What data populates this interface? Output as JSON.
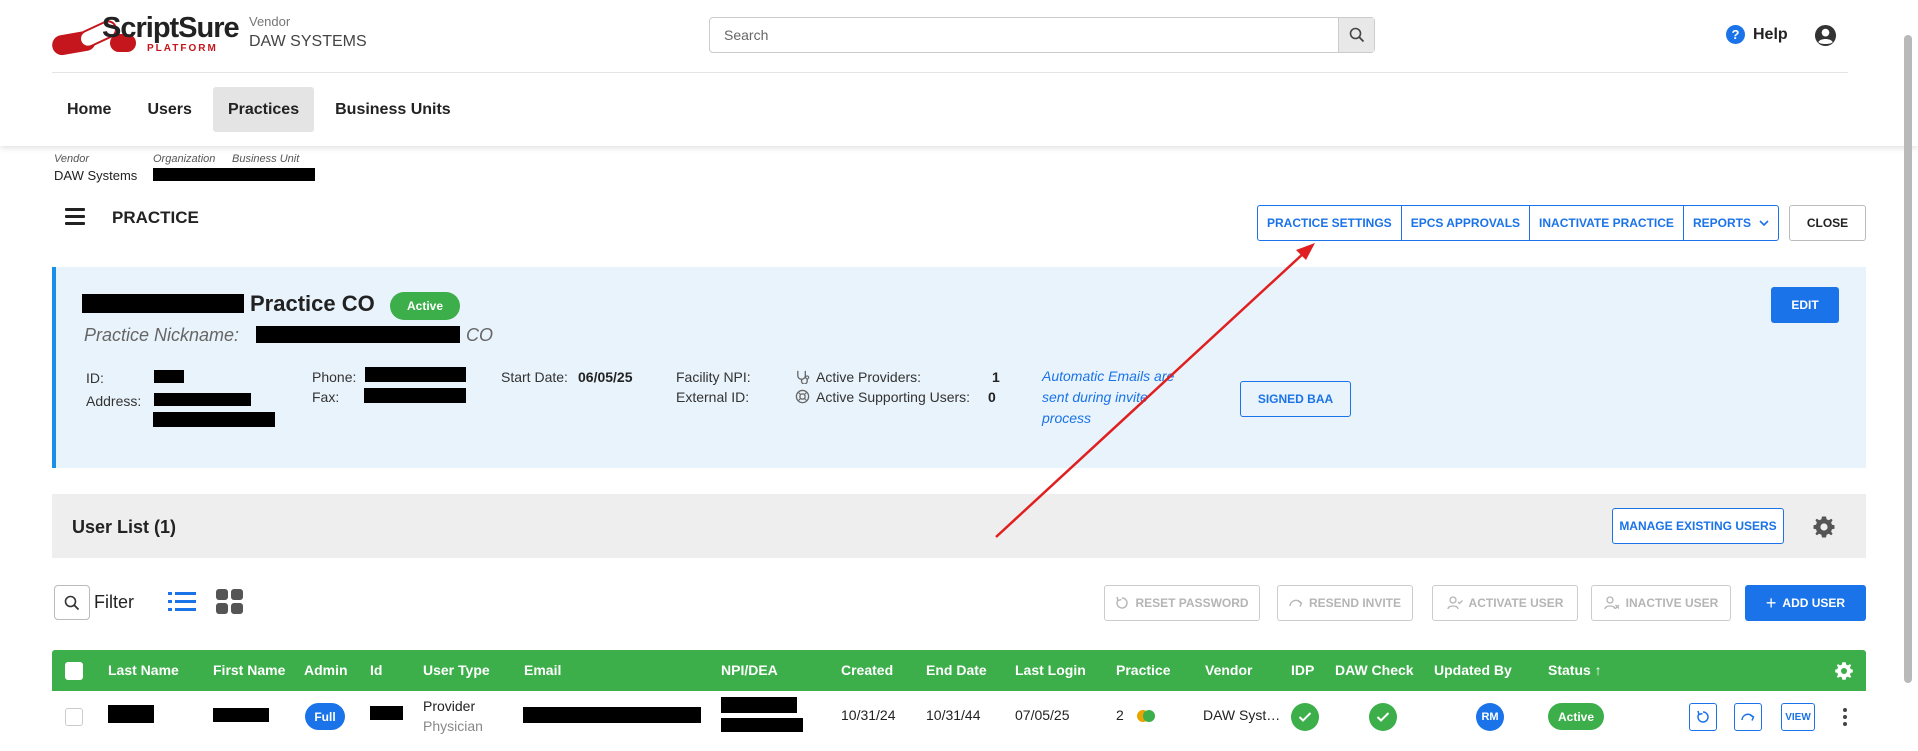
{
  "app": {
    "logo_text": "ScriptSure",
    "logo_sub": "PLATFORM",
    "vendor_label": "Vendor",
    "vendor_name": "DAW SYSTEMS"
  },
  "search": {
    "placeholder": "Search",
    "icon": "search-icon"
  },
  "header": {
    "help_label": "Help",
    "help_icon": "question-circle-icon",
    "account_icon": "user-circle-icon"
  },
  "nav": {
    "tabs": [
      {
        "label": "Home",
        "active": false
      },
      {
        "label": "Users",
        "active": false
      },
      {
        "label": "Practices",
        "active": true
      },
      {
        "label": "Business Units",
        "active": false
      }
    ]
  },
  "breadcrumb": {
    "vendor_label": "Vendor",
    "organization_label": "Organization",
    "business_unit_label": "Business Unit",
    "vendor_value": "DAW Systems"
  },
  "page": {
    "title": "PRACTICE",
    "toolbar": {
      "practice_settings": "PRACTICE SETTINGS",
      "epcs_approvals": "EPCS APPROVALS",
      "inactivate_practice": "INACTIVATE PRACTICE",
      "reports": "REPORTS",
      "close": "CLOSE"
    }
  },
  "practice": {
    "name_suffix": "Practice CO",
    "status": "Active",
    "nickname_label": "Practice Nickname:",
    "nickname_suffix": "CO",
    "edit": "EDIT",
    "id_label": "ID:",
    "address_label": "Address:",
    "phone_label": "Phone:",
    "fax_label": "Fax:",
    "start_date_label": "Start Date:",
    "start_date": "06/05/25",
    "facility_npi_label": "Facility NPI:",
    "external_id_label": "External ID:",
    "active_providers_label": "Active Providers:",
    "active_providers": "1",
    "active_supporting_label": "Active Supporting Users:",
    "active_supporting": "0",
    "auto_emails_note": "Automatic Emails are sent during invite process",
    "signed_baa": "SIGNED BAA"
  },
  "user_list": {
    "title": "User List (1)",
    "manage_existing": "MANAGE EXISTING USERS",
    "filter_label": "Filter",
    "actions": {
      "reset_password": "RESET PASSWORD",
      "resend_invite": "RESEND INVITE",
      "activate_user": "ACTIVATE USER",
      "inactive_user": "INACTIVE USER",
      "add_user": "ADD USER"
    },
    "columns": [
      "Last Name",
      "First Name",
      "Admin",
      "Id",
      "User Type",
      "Email",
      "NPI/DEA",
      "Created",
      "End Date",
      "Last Login",
      "Practice",
      "Vendor",
      "IDP",
      "DAW Check",
      "Updated By",
      "Status ↑"
    ],
    "rows": [
      {
        "admin": "Full",
        "user_type": "Provider",
        "user_subtype": "Physician",
        "created": "10/31/24",
        "end_date": "10/31/44",
        "last_login": "07/05/25",
        "practice": "2",
        "vendor": "DAW Syst…",
        "updated_by": "RM",
        "status": "Active",
        "view": "VIEW"
      }
    ]
  },
  "colors": {
    "accent": "#1a73e8",
    "header_green": "#3cae4a",
    "brand_red": "#c4161c",
    "arrow": "#e02020"
  }
}
